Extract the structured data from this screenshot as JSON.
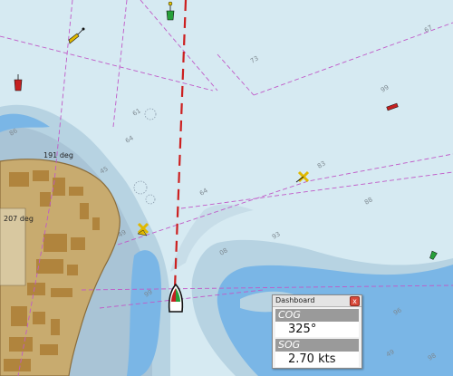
{
  "map": {
    "bearing_labels": [
      "191 deg",
      "207 deg"
    ],
    "soundings": [
      "67",
      "73",
      "61",
      "64",
      "99",
      "83",
      "88",
      "45",
      "64",
      "86",
      "93",
      "08",
      "49",
      "99",
      "96",
      "49",
      "98"
    ],
    "colors": {
      "deep_water": "#d6eaf2",
      "shallow_water": "#b7d3e2",
      "medium_water": "#a9c4d6",
      "very_shallow": "#7ab6e6",
      "land": "#c8ab6f",
      "buildings": "#b0843d",
      "route": "#cc1f1f",
      "limit_line": "#c05ac8"
    },
    "markers": [
      "buoy-icon",
      "buoy-icon",
      "beacon-icon",
      "wreck-icon",
      "wreck-icon",
      "own-ship-icon"
    ]
  },
  "dashboard": {
    "title": "Dashboard",
    "close_label": "x",
    "instruments": [
      {
        "label": "COG",
        "value": "325°"
      },
      {
        "label": "SOG",
        "value": "2.70 kts"
      }
    ]
  }
}
